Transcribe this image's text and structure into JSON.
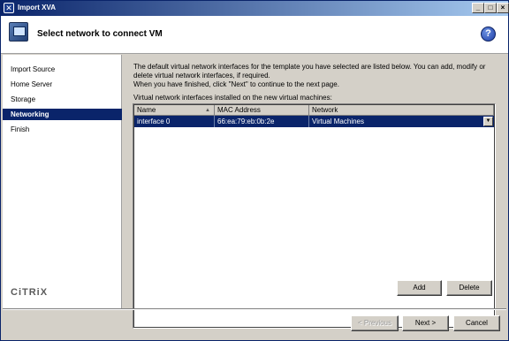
{
  "window": {
    "title": "Import XVA"
  },
  "header": {
    "heading": "Select network to connect VM",
    "help_symbol": "?"
  },
  "steps": [
    {
      "label": "Import Source",
      "active": false
    },
    {
      "label": "Home Server",
      "active": false
    },
    {
      "label": "Storage",
      "active": false
    },
    {
      "label": "Networking",
      "active": true
    },
    {
      "label": "Finish",
      "active": false
    }
  ],
  "brand": {
    "logo_text": "CiTRiX"
  },
  "content": {
    "description": "The default virtual network interfaces for the template you have selected are listed below. You can add, modify or delete virtual network interfaces, if required.",
    "instruction": "When you have finished, click \"Next\" to continue to the next page.",
    "list_label": "Virtual network interfaces installed on the new virtual machines:"
  },
  "grid": {
    "columns": [
      "Name",
      "MAC Address",
      "Network"
    ],
    "rows": [
      {
        "name": "interface 0",
        "mac": "66:ea:79:eb:0b:2e",
        "network": "Virtual Machines"
      }
    ]
  },
  "buttons": {
    "add": "Add",
    "delete": "Delete",
    "previous": "< Previous",
    "next": "Next >",
    "cancel": "Cancel"
  },
  "colors": {
    "selection": "#0a246a",
    "chrome": "#d4d0c8"
  }
}
